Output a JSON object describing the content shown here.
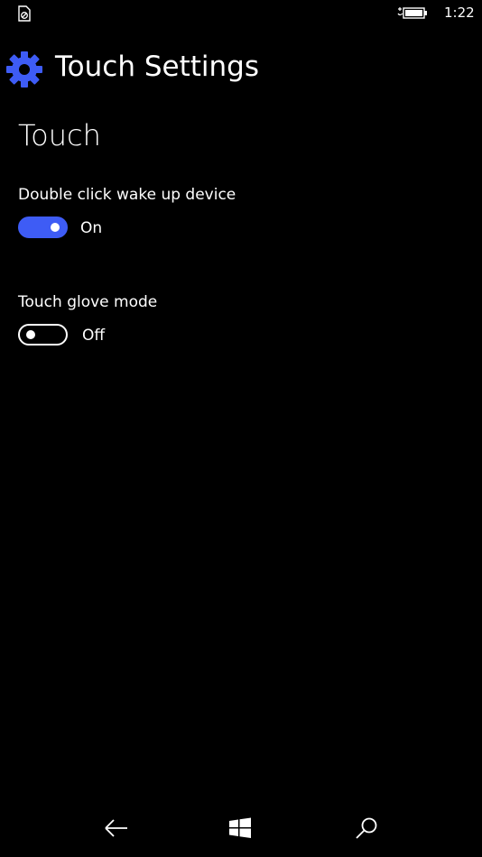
{
  "status_bar": {
    "time": "1:22",
    "left_icon": "no-sim-icon",
    "battery_icon": "battery-charging-icon"
  },
  "header": {
    "icon": "gear-icon",
    "title": "Touch Settings"
  },
  "section": {
    "title": "Touch"
  },
  "settings": [
    {
      "label": "Double click wake up device",
      "state": "On",
      "enabled": true
    },
    {
      "label": "Touch glove mode",
      "state": "Off",
      "enabled": false
    }
  ],
  "nav": {
    "back_icon": "back-arrow-icon",
    "home_icon": "windows-logo-icon",
    "search_icon": "search-icon"
  },
  "colors": {
    "accent": "#3e5cf5",
    "background": "#000000",
    "text": "#ffffff"
  }
}
